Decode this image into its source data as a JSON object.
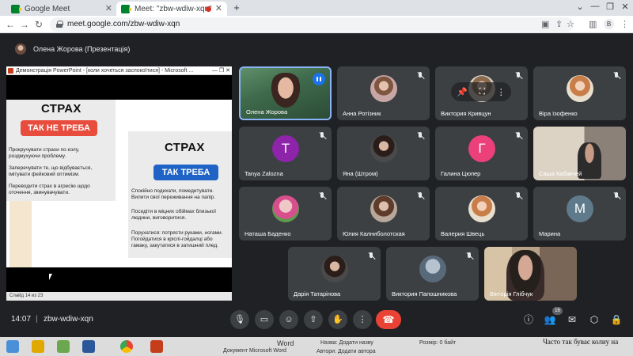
{
  "browser": {
    "tabs": [
      {
        "title": "Google Meet"
      },
      {
        "title": "Meet: \"zbw-wdiw-xqn\""
      }
    ],
    "url": "meet.google.com/zbw-wdiw-xqn",
    "profile_initial": "В"
  },
  "presenter_bar": {
    "text": "Олена Жорова (Презентація)"
  },
  "presentation": {
    "window_title": "Демонстрація PowerPoint - [коли хочеться заспокоїтися] - Microsoft ...",
    "left_card": {
      "heading": "СТРАХ",
      "pill": "ТАК НЕ ТРЕБА",
      "pill_color": "#e84c3d",
      "paragraphs": [
        "Прокручувати страхи по колу, роздмухуючи проблему.",
        "Заперечувати те, що відбувається, імітувати фейковий оптимізм.",
        "Переводити страх в агресію щодо оточення, звинувачувати."
      ]
    },
    "right_card": {
      "heading": "СТРАХ",
      "pill": "ТАК ТРЕБА",
      "pill_color": "#1f63c6",
      "paragraphs": [
        "Спокійно подихати, помедитувати. Вилити свої переживання на папір.",
        "Посидіти в міцних обіймах близької людини, виговоритися.",
        "Порухатися: потрясти руками, ногами. Погойдатися в кріслі-гойдалці або гамаку, закутатися в затишний плед."
      ]
    },
    "status": "Слайд 14 из 23"
  },
  "participants": [
    {
      "name": "Олена Жорова",
      "avatar": "photo",
      "speaking": true
    },
    {
      "name": "Анна Ротізник",
      "avatar": "photo",
      "muted": true
    },
    {
      "name": "Виктория Кривцун",
      "avatar": "photo",
      "muted": true,
      "hover": true
    },
    {
      "name": "Віра Ізофенко",
      "avatar": "photo",
      "muted": true
    },
    {
      "name": "Tanya Zalozna",
      "avatar": "letter",
      "letter": "T",
      "color": "#8e24aa",
      "muted": true
    },
    {
      "name": "Яна (Штром)",
      "avatar": "photo",
      "muted": true
    },
    {
      "name": "Галина Цюпер",
      "avatar": "letter",
      "letter": "Г",
      "color": "#ec407a",
      "muted": true
    },
    {
      "name": "Саша Кабакчей",
      "avatar": "video"
    },
    {
      "name": "Наташа Баденко",
      "avatar": "photo",
      "muted": true
    },
    {
      "name": "Юлия Калниболотская",
      "avatar": "photo",
      "muted": true
    },
    {
      "name": "Валерия Швець",
      "avatar": "photo",
      "muted": true
    },
    {
      "name": "Марина",
      "avatar": "letter",
      "letter": "М",
      "color": "#5f7a8a",
      "muted": true
    },
    {
      "name": "Дарія Татарінова",
      "avatar": "photo",
      "muted": true
    },
    {
      "name": "Виктория Папошникова",
      "avatar": "photo",
      "muted": true
    },
    {
      "name": "Вікторія Глібчук",
      "avatar": "video"
    }
  ],
  "bottom_bar": {
    "time": "14:07",
    "separator": "|",
    "meeting_code": "zbw-wdiw-xqn",
    "participants_count": "16"
  },
  "taskbar": {
    "word_label": "Word",
    "doc_type": "Документ Microsoft Word",
    "title_label": "Назва: Додати назву",
    "author_label": "Автори: Додати автора",
    "size_label": "Розмір: 0 байт",
    "doc_snippet": "Часто так буває колиу на"
  }
}
